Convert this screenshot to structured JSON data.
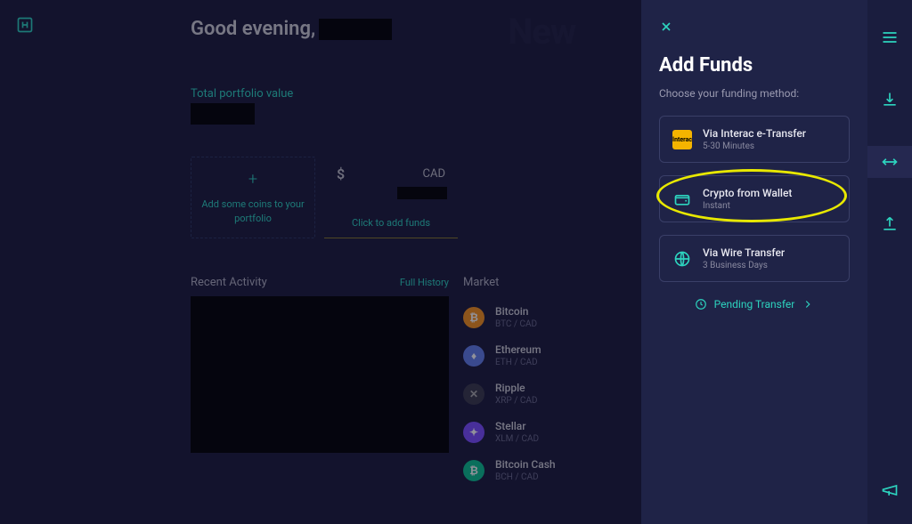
{
  "greeting": "Good evening,",
  "ghost": "New",
  "portfolio": {
    "label": "Total portfolio value"
  },
  "add_coins": {
    "text": "Add some coins to your portfolio"
  },
  "cad_card": {
    "currency": "CAD",
    "cta": "Click to add funds"
  },
  "activity": {
    "title": "Recent Activity",
    "full_history": "Full History"
  },
  "market": {
    "title": "Market",
    "coins": [
      {
        "name": "Bitcoin",
        "pair": "BTC / CAD",
        "sym": "₿",
        "cls": "coin-btc"
      },
      {
        "name": "Ethereum",
        "pair": "ETH / CAD",
        "sym": "♦",
        "cls": "coin-eth"
      },
      {
        "name": "Ripple",
        "pair": "XRP / CAD",
        "sym": "✕",
        "cls": "coin-xrp"
      },
      {
        "name": "Stellar",
        "pair": "XLM / CAD",
        "sym": "✦",
        "cls": "coin-xlm"
      },
      {
        "name": "Bitcoin Cash",
        "pair": "BCH / CAD",
        "sym": "₿",
        "cls": "coin-bch"
      }
    ]
  },
  "panel": {
    "title": "Add Funds",
    "subtitle": "Choose your funding method:",
    "options": [
      {
        "title": "Via Interac e-Transfer",
        "sub": "5-30 Minutes",
        "icon": "interac"
      },
      {
        "title": "Crypto from Wallet",
        "sub": "Instant",
        "icon": "wallet",
        "highlight": true
      },
      {
        "title": "Via Wire Transfer",
        "sub": "3 Business Days",
        "icon": "globe"
      }
    ],
    "pending": "Pending Transfer"
  }
}
